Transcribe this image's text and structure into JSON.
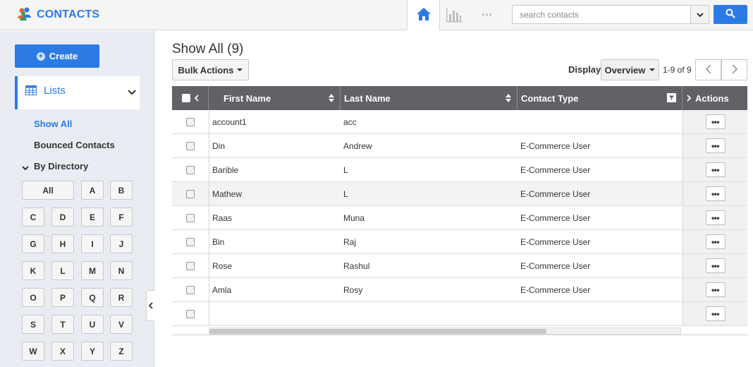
{
  "app": {
    "title": "CONTACTS"
  },
  "header": {
    "nav": [
      {
        "name": "home-icon",
        "active": true
      },
      {
        "name": "chart-icon",
        "active": false
      },
      {
        "name": "more-icon",
        "active": false
      }
    ],
    "more_glyph": "•••",
    "search": {
      "placeholder": "search contacts",
      "value": ""
    }
  },
  "sidebar": {
    "create_label": "Create",
    "lists_label": "Lists",
    "links": [
      {
        "label": "Show All",
        "active": true
      },
      {
        "label": "Bounced Contacts",
        "active": false
      }
    ],
    "directory_label": "By Directory",
    "letters": [
      "All",
      "A",
      "B",
      "C",
      "D",
      "E",
      "F",
      "G",
      "H",
      "I",
      "J",
      "K",
      "L",
      "M",
      "N",
      "O",
      "P",
      "Q",
      "R",
      "S",
      "T",
      "U",
      "V",
      "W",
      "X",
      "Y",
      "Z"
    ]
  },
  "main": {
    "title": "Show All (9)",
    "bulk_actions_label": "Bulk Actions",
    "display_label": "Display",
    "view_select": "Overview",
    "pager_text": "1-9 of 9"
  },
  "table": {
    "columns": [
      "First Name",
      "Last Name",
      "Contact Type",
      "Actions"
    ],
    "action_glyph": "•••",
    "rows": [
      {
        "first": "account1",
        "last": "acc",
        "type": ""
      },
      {
        "first": "Din",
        "last": "Andrew",
        "type": "E-Commerce User"
      },
      {
        "first": "Barible",
        "last": "L",
        "type": "E-Commerce User"
      },
      {
        "first": "Mathew",
        "last": "L",
        "type": "E-Commerce User"
      },
      {
        "first": "Raas",
        "last": "Muna",
        "type": "E-Commerce User"
      },
      {
        "first": "Bin",
        "last": "Raj",
        "type": "E-Commerce User"
      },
      {
        "first": "Rose",
        "last": "Rashul",
        "type": "E-Commerce User"
      },
      {
        "first": "Amla",
        "last": "Rosy",
        "type": "E-Commerce User"
      },
      {
        "first": "",
        "last": "",
        "type": ""
      }
    ]
  },
  "colors": {
    "accent": "#2c7be5",
    "header_bg": "#606266",
    "sidebar_bg": "#e9edf3"
  }
}
